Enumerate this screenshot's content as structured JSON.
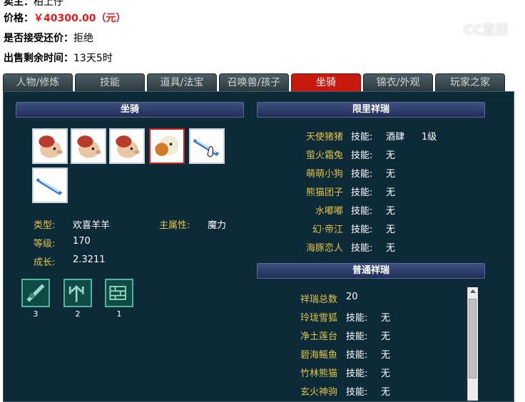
{
  "seller": {
    "label": "卖主：",
    "value": "柏上仔"
  },
  "price": {
    "label": "价格：",
    "value": "￥40300.00（元）"
  },
  "bargain": {
    "label": "是否接受还价：",
    "value": "拒绝"
  },
  "remaining": {
    "label": "出售剩余时间：",
    "value": "13天5时"
  },
  "watermark": "CC直播",
  "tabs": [
    {
      "label": "人物/修炼"
    },
    {
      "label": "技能"
    },
    {
      "label": "道具/法宝"
    },
    {
      "label": "召唤兽/孩子"
    },
    {
      "label": "坐骑"
    },
    {
      "label": "锦衣/外观"
    },
    {
      "label": "玩家之家"
    }
  ],
  "active_tab": "坐骑",
  "mount_section": {
    "title": "坐骑",
    "type_label": "类型:",
    "type_value": "欢喜羊羊",
    "attr_label": "主属性:",
    "attr_value": "魔力",
    "level_label": "等级:",
    "level_value": "170",
    "growth_label": "成长:",
    "growth_value": "2.3211",
    "skills": [
      {
        "icon": "blade-skill-icon",
        "count": "3"
      },
      {
        "icon": "trident-skill-icon",
        "count": "2"
      },
      {
        "icon": "wall-skill-icon",
        "count": "1"
      }
    ]
  },
  "limited": {
    "title": "限里祥瑞",
    "items": [
      {
        "name": "天使猪猪",
        "skill": "技能:",
        "value": "酒肆",
        "level": "1级"
      },
      {
        "name": "萤火霜兔",
        "skill": "技能:",
        "value": "无"
      },
      {
        "name": "萌萌小狗",
        "skill": "技能:",
        "value": "无"
      },
      {
        "name": "熊猫团子",
        "skill": "技能:",
        "value": "无"
      },
      {
        "name": "水嘟嘟",
        "skill": "技能:",
        "value": "无"
      },
      {
        "name": "幻·帝江",
        "skill": "技能:",
        "value": "无"
      },
      {
        "name": "海豚恋人",
        "skill": "技能:",
        "value": "无"
      }
    ]
  },
  "normal": {
    "title": "普通祥瑞",
    "total_label": "祥瑞总数",
    "total_value": "20",
    "items": [
      {
        "name": "玲珑雪狐",
        "skill": "技能:",
        "value": "无"
      },
      {
        "name": "净土莲台",
        "skill": "技能:",
        "value": "无"
      },
      {
        "name": "碧海鳐鱼",
        "skill": "技能:",
        "value": "无"
      },
      {
        "name": "竹林熊猫",
        "skill": "技能:",
        "value": "无"
      },
      {
        "name": "玄火神驹",
        "skill": "技能:",
        "value": "无"
      }
    ]
  }
}
